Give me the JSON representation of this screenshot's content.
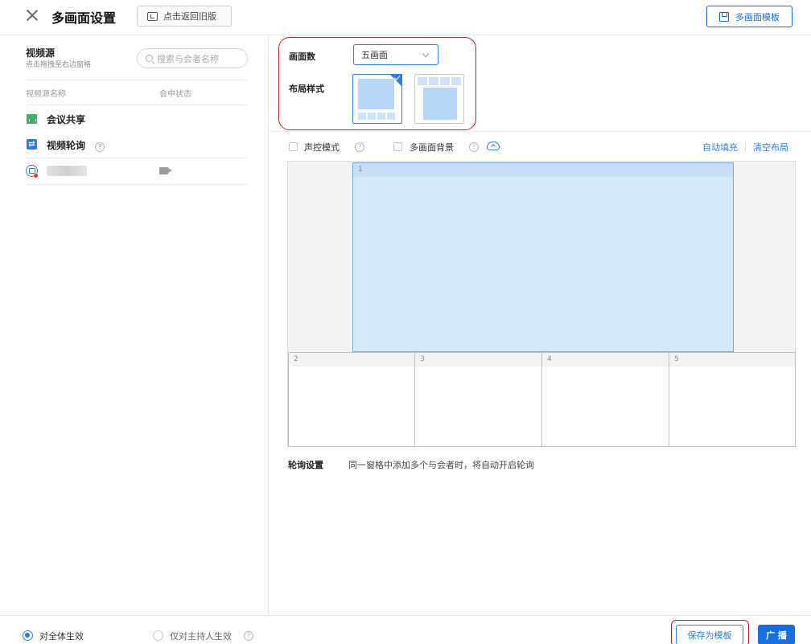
{
  "header": {
    "title": "多画面设置",
    "old_version_label": "点击返回旧版",
    "template_label": "多画面模板"
  },
  "sources": {
    "title": "视频源",
    "subtitle": "点击拖拽至右边窗格",
    "search_placeholder": "搜索与会者名称",
    "col_name": "视频源名称",
    "col_status": "会中状态",
    "items": [
      {
        "label": "会议共享",
        "icon": "screen-share-icon"
      },
      {
        "label": "视频轮询",
        "icon": "rotate-icon"
      }
    ]
  },
  "config": {
    "count_label": "画面数",
    "count_value": "五画面",
    "layout_label": "布局样式"
  },
  "options": {
    "voice_mode": "声控模式",
    "background": "多画面背景",
    "auto_fill": "自动填充",
    "clear_layout": "清空布局"
  },
  "panes": [
    "1",
    "2",
    "3",
    "4",
    "5"
  ],
  "polling": {
    "label": "轮询设置",
    "description": "同一窗格中添加多个与会者时，将自动开启轮询"
  },
  "footer": {
    "scope_all": "对全体生效",
    "scope_host": "仅对主持人生效",
    "save_template": "保存为模板",
    "broadcast": "广 播"
  },
  "colors": {
    "accent": "#1a6fe0",
    "highlight_outline": "#b8242c",
    "pane_fill": "#d6e9fb"
  }
}
